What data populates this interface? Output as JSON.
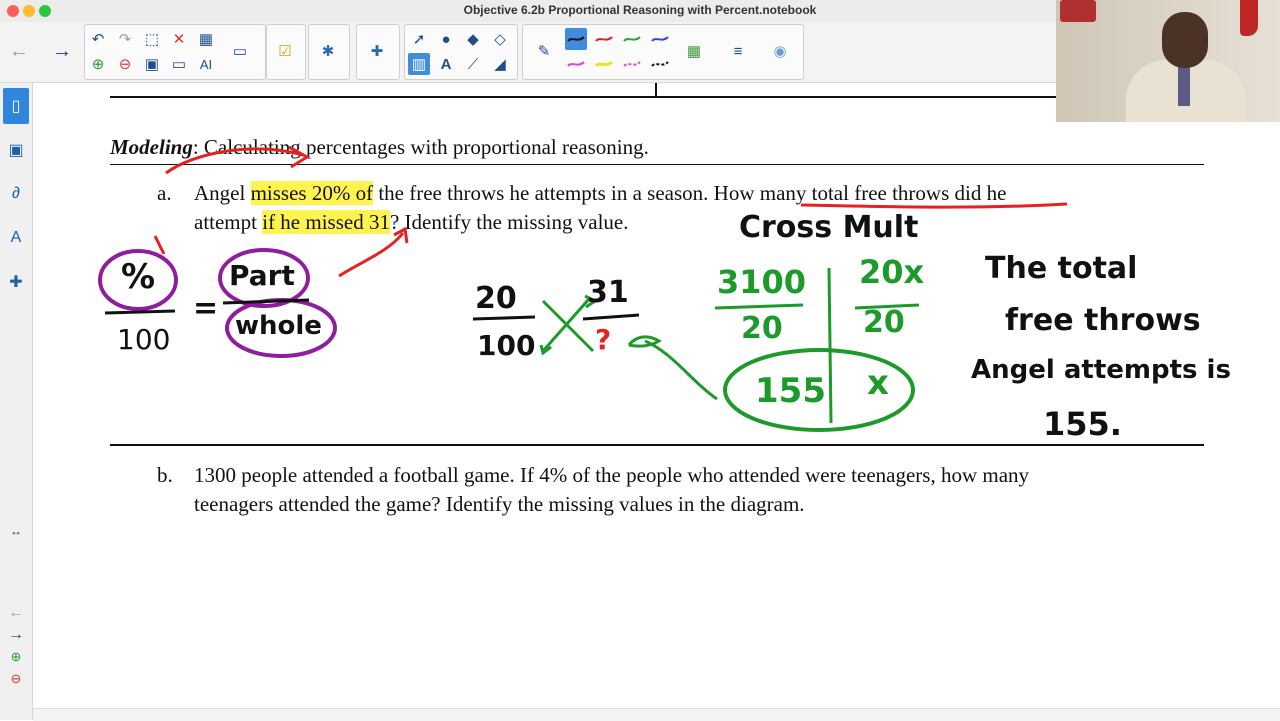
{
  "window": {
    "title": "Objective 6.2b Proportional Reasoning with Percent.notebook"
  },
  "toolbar": {
    "tools": [
      {
        "name": "back-icon",
        "glyph": "←"
      },
      {
        "name": "forward-icon",
        "glyph": "→"
      },
      {
        "name": "undo-icon",
        "glyph": "↶"
      },
      {
        "name": "redo-icon",
        "glyph": "↷"
      },
      {
        "name": "delete-icon",
        "glyph": "✕"
      },
      {
        "name": "table-icon",
        "glyph": "▦"
      },
      {
        "name": "screen-shade-icon",
        "glyph": "▭"
      },
      {
        "name": "response-icon",
        "glyph": "☑"
      },
      {
        "name": "addons-icon",
        "glyph": "✱"
      },
      {
        "name": "activity-builder-icon",
        "glyph": "✚"
      },
      {
        "name": "select-icon",
        "glyph": "➚"
      },
      {
        "name": "shapes-icon",
        "glyph": "●"
      },
      {
        "name": "fill-icon",
        "glyph": "◆"
      },
      {
        "name": "text-icon",
        "glyph": "A"
      },
      {
        "name": "line-icon",
        "glyph": "⟋"
      },
      {
        "name": "eraser-icon",
        "glyph": "◢"
      },
      {
        "name": "pen-icon",
        "glyph": "✎"
      },
      {
        "name": "magic-pen-icon",
        "glyph": "✦"
      },
      {
        "name": "color-palette-icon",
        "glyph": "▦"
      },
      {
        "name": "line-style-icon",
        "glyph": "≡"
      },
      {
        "name": "properties-icon",
        "glyph": "◉"
      }
    ],
    "pen_colors": [
      "#1a1a1a",
      "#e02020",
      "#1faa2a",
      "#3a43d8",
      "#e040e0",
      "#f0e020",
      "#e040e0",
      "#1a1a1a"
    ]
  },
  "document": {
    "section_label": "Modeling",
    "section_rest": ": Calculating percentages with proportional reasoning.",
    "problem_a": {
      "letter": "a.",
      "t1": "Angel ",
      "t2": "misses 20% of",
      "t3": " the free throws he attempts in a season. ",
      "t4": "How many total free throws",
      "t5": " did he",
      "t6": "attempt ",
      "t7": "if he missed 31",
      "t8": "? Identify the missing value."
    },
    "problem_b": {
      "letter": "b.",
      "line1": "1300 people attended a football game. If 4% of the people who attended were teenagers, how many",
      "line2": "teenagers attended the game? Identify the missing values in the diagram."
    }
  },
  "annotations": {
    "cross_mult": "Cross Mult",
    "percent": "%",
    "hundred": "100",
    "part": "Part",
    "whole": "whole",
    "equals": "=",
    "f_num": "20",
    "f_den": "100",
    "f2_num": "31",
    "question": "?",
    "g1_num": "3100",
    "g1_den": "20",
    "g2_num": "20x",
    "g2_den": "20",
    "answer_val": "155",
    "answer_x": "x",
    "conclusion_1": "The total",
    "conclusion_2": "free throws",
    "conclusion_3": "Angel attempts is",
    "conclusion_4": "155."
  }
}
